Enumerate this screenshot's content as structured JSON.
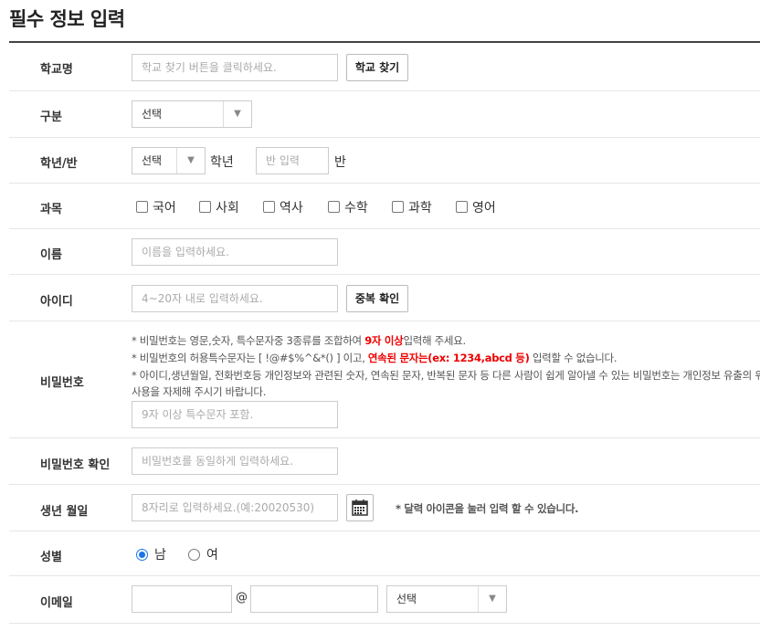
{
  "title": "필수 정보 입력",
  "school": {
    "label": "학교명",
    "placeholder": "학교 찾기 버튼을 클릭하세요.",
    "button": "학교 찾기"
  },
  "division": {
    "label": "구분",
    "selected": "선택"
  },
  "grade_class": {
    "label": "학년/반",
    "grade_selected": "선택",
    "grade_unit": "학년",
    "class_placeholder": "반 입력",
    "class_unit": "반"
  },
  "subjects": {
    "label": "과목",
    "options": [
      "국어",
      "사회",
      "역사",
      "수학",
      "과학",
      "영어"
    ]
  },
  "name": {
    "label": "이름",
    "placeholder": "이름을 입력하세요."
  },
  "user_id": {
    "label": "아이디",
    "placeholder": "4~20자 내로 입력하세요.",
    "button": "중복 확인"
  },
  "password": {
    "label": "비밀번호",
    "note1_a": "* 비밀번호는 영문,숫자, 특수문자중 3종류를 조합하여 ",
    "note1_red": "9자 이상",
    "note1_b": "입력해 주세요.",
    "note2_a": "* 비밀번호의 허용특수문자는 [ !@#$%^&*() ] 이고, ",
    "note2_red": "연속된 문자는(ex: 1234,abcd 등)",
    "note2_b": " 입력할 수 없습니다.",
    "note3": "* 아이디,생년월일, 전화번호등 개인정보와 관련된 숫자, 연속된 문자, 반복된 문자 등 다른 사람이 쉽게 알아낼 수 있는 비밀번호는 개인정보 유출의 위",
    "note4": "사용을 자제해 주시기 바랍니다.",
    "placeholder": "9자 이상 특수문자 포함."
  },
  "password_confirm": {
    "label": "비밀번호 확인",
    "placeholder": "비밀번호를 동일하게 입력하세요."
  },
  "birth": {
    "label": "생년 월일",
    "placeholder": "8자리로 입력하세요.(예:20020530)",
    "hint": "* 달력 아이콘을 눌러 입력 할 수 있습니다."
  },
  "gender": {
    "label": "성별",
    "options": [
      "남",
      "여"
    ],
    "selected_index": 0
  },
  "email": {
    "label": "이메일",
    "at": "@",
    "domain_selected": "선택"
  },
  "icons": {
    "dropdown": "chevron-down-icon",
    "calendar": "calendar-icon"
  }
}
